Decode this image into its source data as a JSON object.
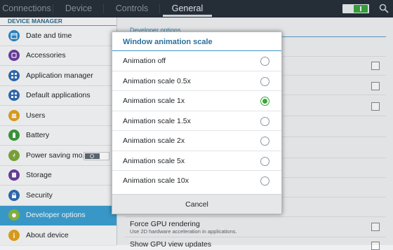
{
  "top_tabs": [
    {
      "label": "Connections"
    },
    {
      "label": "Device"
    },
    {
      "label": "Controls"
    },
    {
      "label": "General"
    }
  ],
  "sidebar": {
    "header": "DEVICE MANAGER",
    "items": [
      {
        "label": "Date and time",
        "icon": "calendar-icon",
        "color": "#2b86c6"
      },
      {
        "label": "Accessories",
        "icon": "accessories-icon",
        "color": "#6c3fa0"
      },
      {
        "label": "Application manager",
        "icon": "apps-grid-icon",
        "color": "#2f6bb4"
      },
      {
        "label": "Default applications",
        "icon": "default-apps-icon",
        "color": "#2f6bb4"
      },
      {
        "label": "Users",
        "icon": "users-icon",
        "color": "#e2a21c"
      },
      {
        "label": "Battery",
        "icon": "battery-icon",
        "color": "#3a9b3c"
      },
      {
        "label": "Power saving mo..",
        "icon": "power-saving-icon",
        "color": "#7ea83c"
      },
      {
        "label": "Storage",
        "icon": "storage-icon",
        "color": "#6c3fa0"
      },
      {
        "label": "Security",
        "icon": "lock-icon",
        "color": "#2f6bb4"
      },
      {
        "label": "Developer options",
        "icon": "developer-icon",
        "color": "#8bb83e"
      },
      {
        "label": "About device",
        "icon": "info-icon",
        "color": "#e2a21c"
      }
    ]
  },
  "content": {
    "section_header": "Developer options",
    "gpu_title": "Force GPU rendering",
    "gpu_desc": "Use 2D hardware acceleration in applications.",
    "gpu2_title": "Show GPU view updates"
  },
  "dialog": {
    "title": "Window animation scale",
    "options": [
      {
        "label": "Animation off",
        "selected": false
      },
      {
        "label": "Animation scale 0.5x",
        "selected": false
      },
      {
        "label": "Animation scale 1x",
        "selected": true
      },
      {
        "label": "Animation scale 1.5x",
        "selected": false
      },
      {
        "label": "Animation scale 2x",
        "selected": false
      },
      {
        "label": "Animation scale 5x",
        "selected": false
      },
      {
        "label": "Animation scale 10x",
        "selected": false
      }
    ],
    "cancel_label": "Cancel"
  },
  "colors": {
    "accent": "#3ca0d2",
    "radio_selected": "#3aa53e",
    "topbar": "#27303a"
  }
}
